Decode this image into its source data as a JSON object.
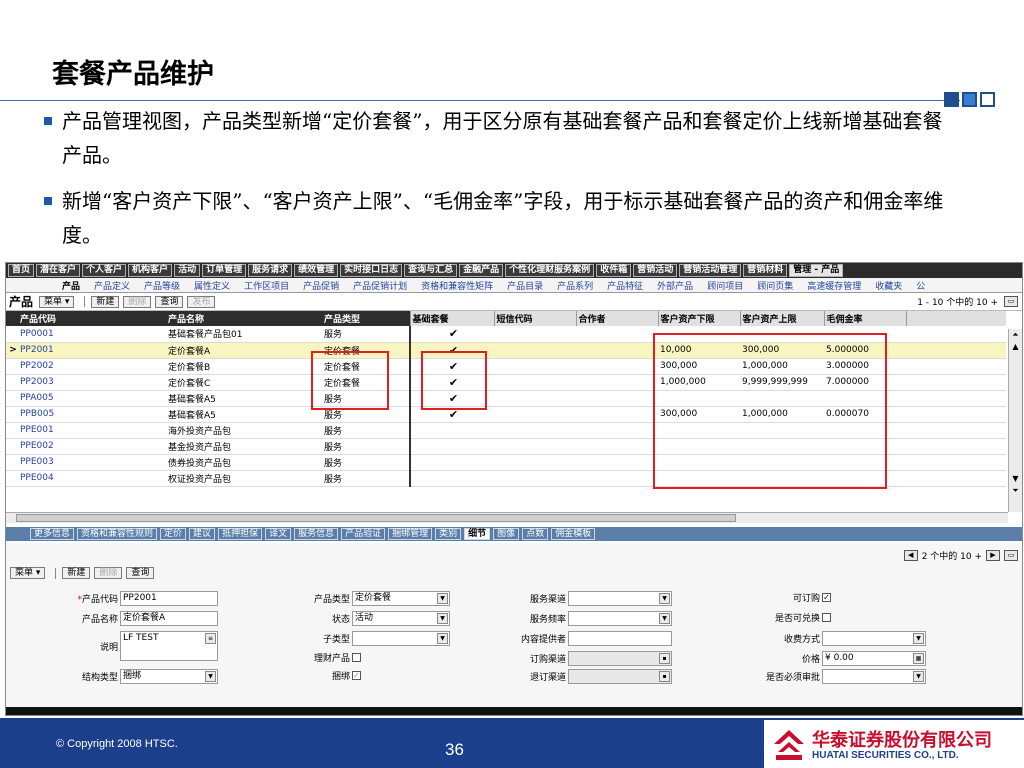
{
  "slide": {
    "title": "套餐产品维护",
    "bullets": [
      "产品管理视图，产品类型新增“定价套餐”，用于区分原有基础套餐产品和套餐定价上线新增基础套餐产品。",
      "新增“客户资产下限”、“客户资产上限”、“毛佣金率”字段，用于标示基础套餐产品的资产和佣金率维度。"
    ],
    "copyright": "© Copyright 2008 HTSC.",
    "page_number": "36",
    "logo_cn": "华泰证券股份有限公司",
    "logo_en": "HUATAI SECURITIES CO., LTD."
  },
  "topnav": [
    "首页",
    "潜在客户",
    "个人客户",
    "机构客户",
    "活动",
    "订单管理",
    "服务请求",
    "绩效管理",
    "实时接口日志",
    "查询与汇总",
    "金融产品",
    "个性化理财服务案例",
    "收件箱",
    "营销活动",
    "营销活动管理",
    "营销材料",
    "管理 - 产品"
  ],
  "subnav": [
    "产品",
    "产品定义",
    "产品等级",
    "属性定义",
    "工作区项目",
    "产品促销",
    "产品促销计划",
    "资格和兼容性矩阵",
    "产品目录",
    "产品系列",
    "产品特征",
    "外部产品",
    "顾问项目",
    "顾问页集",
    "高速缓存管理",
    "收藏夹",
    "公"
  ],
  "list": {
    "title": "产品",
    "menu_btn": "菜单 ▾",
    "new_btn": "新建",
    "delete_btn": "删除",
    "query_btn": "查询",
    "publish_btn": "发布",
    "pager": "1 - 10 个中的 10 +",
    "columns": [
      "产品代码",
      "产品名称",
      "产品类型",
      "基础套餐",
      "短信代码",
      "合作者",
      "客户资产下限",
      "客户资产上限",
      "毛佣金率"
    ],
    "rows": [
      {
        "marker": "",
        "code": "PP0001",
        "name": "基础套餐产品包01",
        "type": "服务",
        "base": "✔",
        "sms": "",
        "partner": "",
        "min": "",
        "max": "",
        "rate": ""
      },
      {
        "marker": ">",
        "code": "PP2001",
        "name": "定价套餐A",
        "type": "定价套餐",
        "base": "✔",
        "sms": "",
        "partner": "",
        "min": "10,000",
        "max": "300,000",
        "rate": "5.000000"
      },
      {
        "marker": "",
        "code": "PP2002",
        "name": "定价套餐B",
        "type": "定价套餐",
        "base": "✔",
        "sms": "",
        "partner": "",
        "min": "300,000",
        "max": "1,000,000",
        "rate": "3.000000"
      },
      {
        "marker": "",
        "code": "PP2003",
        "name": "定价套餐C",
        "type": "定价套餐",
        "base": "✔",
        "sms": "",
        "partner": "",
        "min": "1,000,000",
        "max": "9,999,999,999",
        "rate": "7.000000"
      },
      {
        "marker": "",
        "code": "PPA005",
        "name": "基础套餐A5",
        "type": "服务",
        "base": "✔",
        "sms": "",
        "partner": "",
        "min": "",
        "max": "",
        "rate": ""
      },
      {
        "marker": "",
        "code": "PPB005",
        "name": "基础套餐A5",
        "type": "服务",
        "base": "✔",
        "sms": "",
        "partner": "",
        "min": "300,000",
        "max": "1,000,000",
        "rate": "0.000070"
      },
      {
        "marker": "",
        "code": "PPE001",
        "name": "海外投资产品包",
        "type": "服务",
        "base": "",
        "sms": "",
        "partner": "",
        "min": "",
        "max": "",
        "rate": ""
      },
      {
        "marker": "",
        "code": "PPE002",
        "name": "基金投资产品包",
        "type": "服务",
        "base": "",
        "sms": "",
        "partner": "",
        "min": "",
        "max": "",
        "rate": ""
      },
      {
        "marker": "",
        "code": "PPE003",
        "name": "债券投资产品包",
        "type": "服务",
        "base": "",
        "sms": "",
        "partner": "",
        "min": "",
        "max": "",
        "rate": ""
      },
      {
        "marker": "",
        "code": "PPE004",
        "name": "权证投资产品包",
        "type": "服务",
        "base": "",
        "sms": "",
        "partner": "",
        "min": "",
        "max": "",
        "rate": ""
      }
    ]
  },
  "detail_tabs": [
    "更多信息",
    "资格和兼容性规则",
    "定价",
    "建议",
    "抵押担保",
    "译文",
    "服务信息",
    "产品验证",
    "捆绑管理",
    "类别",
    "细节",
    "图像",
    "点数",
    "佣金模板"
  ],
  "detail_tab_active": "细节",
  "detail": {
    "pager": "2 个中的 10 +",
    "menu_btn": "菜单 ▾",
    "new_btn": "新建",
    "delete_btn": "删除",
    "query_btn": "查询",
    "req_mark": "*",
    "product_code_label": "产品代码",
    "product_code": "PP2001",
    "product_name_label": "产品名称",
    "product_name": "定价套餐A",
    "desc_label": "说明",
    "desc": "LF TEST",
    "struct_label": "结构类型",
    "struct": "捆绑",
    "ptype_label": "产品类型",
    "ptype": "定价套餐",
    "status_label": "状态",
    "status": "活动",
    "subtype_label": "子类型",
    "subtype": "",
    "finprod_label": "理财产品",
    "bundle_label": "捆绑",
    "channel_label": "服务渠道",
    "freq_label": "服务频率",
    "provider_label": "内容提供者",
    "order_channel_label": "订购渠道",
    "unsub_channel_label": "退订渠道",
    "orderable_label": "可订购",
    "redeemable_label": "是否可兑换",
    "fee_label": "收费方式",
    "price_label": "价格",
    "price": "¥ 0.00",
    "approval_label": "是否必须审批"
  }
}
